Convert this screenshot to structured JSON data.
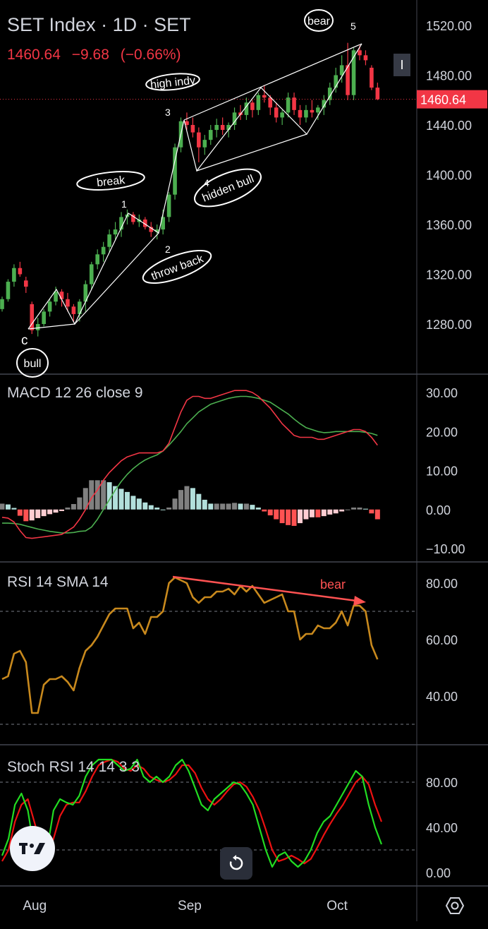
{
  "header": {
    "title": "SET Index · 1D · SET",
    "last": "1460.64",
    "change": "−9.68",
    "change_pct": "(−0.66%)"
  },
  "price_scale": {
    "current_tag": "1460.64",
    "current_tag_color": "#f23645"
  },
  "toolbar": {
    "lock_label": "I"
  },
  "panes": {
    "macd": {
      "label": "MACD 12 26 close 9",
      "ticks": [
        "30.00",
        "20.00",
        "10.00",
        "0.00",
        "−10.00"
      ]
    },
    "rsi": {
      "label": "RSI 14 SMA 14",
      "ticks": [
        "80.00",
        "60.00",
        "40.00"
      ]
    },
    "stoch": {
      "label": "Stoch RSI 14 14 3 3",
      "ticks": [
        "80.00",
        "40.00",
        "0.00"
      ]
    }
  },
  "time_axis": [
    "Aug",
    "Sep",
    "Oct"
  ],
  "annotations": {
    "bull": "bull",
    "c": "c",
    "break": "break",
    "one": "1",
    "two": "2",
    "throw_back": "throw back",
    "three": "3",
    "high_indy": "high indy",
    "four": "4",
    "hidden_bull": "hidden bull",
    "five": "5",
    "bear_top": "bear",
    "bear_rsi": "bear"
  },
  "colors": {
    "up": "#4caf50",
    "down": "#f23645",
    "macd_line": "#f23645",
    "signal_line": "#4caf50",
    "rsi_line": "#c8891d",
    "stoch_k": "#22dd22",
    "stoch_d": "#ee1111",
    "hist_pos_strong": "#26a69a",
    "hist_pos_grey": "#808080",
    "hist_pos_light": "#b2dfdb",
    "hist_neg_strong": "#ff5252",
    "hist_neg_light": "#ffcdd2"
  },
  "chart_data": {
    "type": "candlestick",
    "price_ticks": [
      1520,
      1480,
      1440,
      1400,
      1360,
      1320,
      1280
    ],
    "ohlc": [
      [
        1292,
        1302,
        1290,
        1300
      ],
      [
        1300,
        1316,
        1298,
        1314
      ],
      [
        1314,
        1328,
        1310,
        1325
      ],
      [
        1325,
        1330,
        1318,
        1320
      ],
      [
        1315,
        1318,
        1305,
        1310
      ],
      [
        1296,
        1298,
        1272,
        1275
      ],
      [
        1275,
        1285,
        1270,
        1280
      ],
      [
        1280,
        1292,
        1278,
        1290
      ],
      [
        1290,
        1300,
        1286,
        1298
      ],
      [
        1298,
        1310,
        1295,
        1306
      ],
      [
        1306,
        1308,
        1294,
        1300
      ],
      [
        1300,
        1305,
        1290,
        1294
      ],
      [
        1294,
        1296,
        1282,
        1288
      ],
      [
        1288,
        1300,
        1282,
        1298
      ],
      [
        1298,
        1315,
        1290,
        1312
      ],
      [
        1312,
        1330,
        1308,
        1328
      ],
      [
        1328,
        1340,
        1324,
        1336
      ],
      [
        1336,
        1346,
        1330,
        1342
      ],
      [
        1342,
        1356,
        1338,
        1352
      ],
      [
        1352,
        1362,
        1348,
        1356
      ],
      [
        1356,
        1370,
        1350,
        1366
      ],
      [
        1366,
        1372,
        1360,
        1368
      ],
      [
        1368,
        1370,
        1360,
        1362
      ],
      [
        1362,
        1368,
        1358,
        1364
      ],
      [
        1364,
        1366,
        1356,
        1358
      ],
      [
        1358,
        1362,
        1350,
        1354
      ],
      [
        1354,
        1360,
        1348,
        1356
      ],
      [
        1356,
        1372,
        1352,
        1366
      ],
      [
        1366,
        1386,
        1362,
        1384
      ],
      [
        1384,
        1425,
        1380,
        1422
      ],
      [
        1422,
        1446,
        1418,
        1443
      ],
      [
        1443,
        1450,
        1436,
        1440
      ],
      [
        1440,
        1446,
        1430,
        1434
      ],
      [
        1434,
        1438,
        1410,
        1422
      ],
      [
        1422,
        1432,
        1416,
        1428
      ],
      [
        1428,
        1440,
        1424,
        1436
      ],
      [
        1436,
        1445,
        1430,
        1440
      ],
      [
        1440,
        1446,
        1432,
        1436
      ],
      [
        1436,
        1442,
        1430,
        1440
      ],
      [
        1440,
        1454,
        1436,
        1450
      ],
      [
        1450,
        1456,
        1444,
        1448
      ],
      [
        1448,
        1462,
        1444,
        1458
      ],
      [
        1458,
        1460,
        1446,
        1452
      ],
      [
        1452,
        1466,
        1448,
        1464
      ],
      [
        1464,
        1472,
        1458,
        1462
      ],
      [
        1462,
        1464,
        1448,
        1454
      ],
      [
        1454,
        1458,
        1442,
        1446
      ],
      [
        1446,
        1452,
        1440,
        1450
      ],
      [
        1450,
        1466,
        1446,
        1462
      ],
      [
        1462,
        1466,
        1448,
        1452
      ],
      [
        1452,
        1456,
        1440,
        1446
      ],
      [
        1446,
        1456,
        1442,
        1452
      ],
      [
        1452,
        1460,
        1446,
        1450
      ],
      [
        1450,
        1456,
        1444,
        1454
      ],
      [
        1454,
        1464,
        1448,
        1460
      ],
      [
        1460,
        1474,
        1456,
        1470
      ],
      [
        1470,
        1486,
        1466,
        1480
      ],
      [
        1480,
        1496,
        1474,
        1488
      ],
      [
        1488,
        1506,
        1460,
        1464
      ],
      [
        1464,
        1502,
        1460,
        1500
      ],
      [
        1500,
        1504,
        1492,
        1496
      ],
      [
        1496,
        1500,
        1488,
        1492
      ],
      [
        1486,
        1488,
        1468,
        1470
      ],
      [
        1470,
        1474,
        1460,
        1460.64
      ]
    ],
    "macd": [
      -2,
      -2.2,
      -3.2,
      -5.4,
      -7.2,
      -7.4,
      -7.2,
      -7,
      -6.8,
      -6.6,
      -6.4,
      -5.5,
      -4.5,
      -2.5,
      0,
      3,
      5,
      7.5,
      9.5,
      11,
      12.5,
      13.5,
      14,
      14.5,
      14.5,
      14.5,
      14.5,
      15,
      17,
      21,
      25,
      28,
      29,
      29,
      28.5,
      28.5,
      29,
      29.5,
      30,
      30.5,
      30.5,
      30.5,
      30,
      29,
      27.5,
      26,
      24,
      22,
      20.5,
      19,
      18.5,
      18.5,
      18.5,
      18,
      18,
      18.5,
      19,
      19.5,
      20,
      20.5,
      20.5,
      20,
      18.5,
      16.5
    ],
    "signal": [
      -3.5,
      -3.5,
      -3.6,
      -3.8,
      -4.2,
      -4.6,
      -5,
      -5.3,
      -5.6,
      -5.8,
      -6,
      -6,
      -5.9,
      -5.6,
      -5.5,
      -4.5,
      -2.5,
      0,
      2.5,
      5,
      7.2,
      9,
      10.5,
      11.7,
      12.7,
      13.4,
      14,
      15,
      16.5,
      18.2,
      20,
      22,
      23.5,
      25,
      26,
      27,
      27.5,
      28,
      28.5,
      28.8,
      29,
      29,
      28.8,
      28.5,
      28,
      27.5,
      26.5,
      25.5,
      24.5,
      23.2,
      22,
      21,
      20.5,
      20,
      19.7,
      19.8,
      20,
      20,
      20,
      20,
      20,
      19.8,
      19.5,
      19
    ],
    "hist": [
      1.5,
      1.3,
      0.4,
      -1.6,
      -3,
      -2.8,
      -2.2,
      -1.7,
      -1.2,
      -0.8,
      -0.4,
      0.5,
      1.4,
      3.1,
      5.5,
      7.5,
      7.5,
      7.5,
      7,
      6,
      5.3,
      4.5,
      3.5,
      2.8,
      1.8,
      1.1,
      0.5,
      0,
      0.5,
      2.8,
      5,
      6,
      5.5,
      4,
      2.5,
      1.5,
      1.5,
      1.5,
      1.5,
      1.7,
      1.5,
      1.5,
      1.2,
      0.5,
      -0.5,
      -1.5,
      -2.5,
      -3.5,
      -4,
      -4.2,
      -3.5,
      -2.5,
      -2,
      -2,
      -1.7,
      -1.3,
      -1,
      -0.5,
      0,
      0.5,
      0.5,
      0.2,
      -1,
      -2.5
    ],
    "rsi": [
      46,
      47,
      55,
      56,
      52,
      34,
      34,
      44,
      46,
      46,
      47,
      45,
      42,
      50,
      56,
      58,
      61,
      65,
      69,
      71,
      71,
      71,
      64,
      66,
      62,
      68,
      68,
      70,
      80,
      82,
      81,
      80,
      75,
      73,
      75,
      75,
      77,
      77,
      78,
      76,
      79,
      77,
      79,
      76,
      73,
      74,
      75,
      76,
      70,
      70,
      60,
      62,
      62,
      65,
      64,
      64,
      66,
      70,
      65,
      72,
      72,
      70,
      58,
      53
    ],
    "rsi_ticks": [
      80,
      60,
      40
    ],
    "rsi_bands": [
      70,
      30
    ],
    "stoch_k": [
      15,
      30,
      60,
      70,
      55,
      20,
      5,
      20,
      55,
      65,
      62,
      60,
      68,
      85,
      95,
      100,
      100,
      100,
      95,
      90,
      92,
      100,
      85,
      80,
      85,
      80,
      85,
      95,
      100,
      90,
      75,
      60,
      55,
      65,
      70,
      75,
      80,
      78,
      70,
      60,
      40,
      20,
      5,
      15,
      18,
      10,
      5,
      10,
      20,
      35,
      45,
      50,
      60,
      70,
      80,
      90,
      85,
      60,
      40,
      25
    ],
    "stoch_d": [
      10,
      20,
      45,
      60,
      65,
      45,
      25,
      15,
      30,
      50,
      60,
      62,
      62,
      72,
      85,
      95,
      98,
      100,
      98,
      92,
      90,
      95,
      92,
      85,
      82,
      80,
      82,
      87,
      95,
      95,
      88,
      75,
      65,
      60,
      65,
      72,
      78,
      80,
      76,
      67,
      55,
      38,
      20,
      10,
      12,
      15,
      12,
      8,
      12,
      22,
      33,
      43,
      52,
      60,
      70,
      80,
      85,
      78,
      60,
      45
    ],
    "stoch_ticks": [
      80,
      40,
      0
    ],
    "stoch_bands": [
      80,
      20
    ],
    "x_labels": [
      "Aug",
      "Sep",
      "Oct"
    ],
    "x_label_bars": [
      3,
      29,
      54
    ]
  }
}
